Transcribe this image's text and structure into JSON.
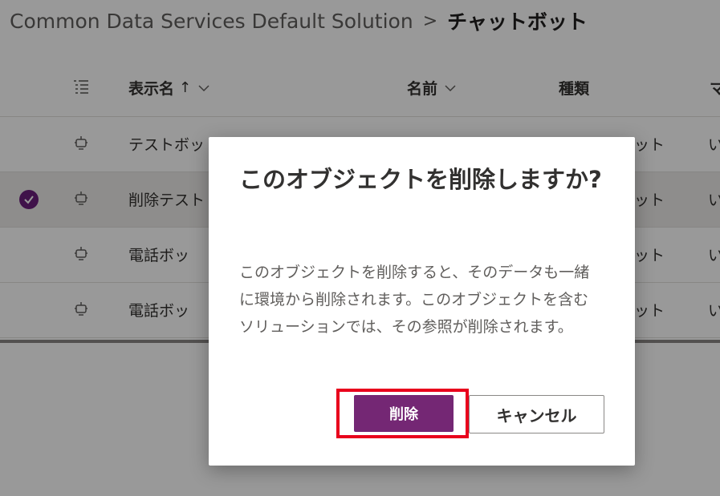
{
  "breadcrumb": {
    "root": "Common Data Services Default Solution",
    "separator": ">",
    "current": "チャットボット"
  },
  "grid": {
    "columns": [
      {
        "key": "display_name",
        "label": "表示名",
        "sort": "↑"
      },
      {
        "key": "name",
        "label": "名前"
      },
      {
        "key": "type",
        "label": "種類"
      },
      {
        "key": "managed",
        "label": "マ"
      }
    ],
    "rows": [
      {
        "display_name": "テストボッ",
        "name": "",
        "type": "ット",
        "managed": "い",
        "selected": false
      },
      {
        "display_name": "削除テスト",
        "name": "",
        "type": "ット",
        "managed": "い",
        "selected": true
      },
      {
        "display_name": "電話ボッ",
        "name": "",
        "type": "ット",
        "managed": "い",
        "selected": false
      },
      {
        "display_name": "電話ボッ",
        "name": "",
        "type": "ット",
        "managed": "い",
        "selected": false
      }
    ]
  },
  "dialog": {
    "title": "このオブジェクトを削除しますか?",
    "body": "このオブジェクトを削除すると、そのデータも一緒に環境から削除されます。このオブジェクトを含むソリューションでは、その参照が削除されます。",
    "delete_label": "削除",
    "cancel_label": "キャンセル"
  },
  "colors": {
    "primary": "#742774",
    "check": "#6b1f7c",
    "highlight": "#e8001c"
  },
  "icons": {
    "column_options": "list-icon",
    "row": "bot-icon",
    "selected": "checkmark-circle-icon",
    "sort_menu": "chevron-down-icon"
  }
}
